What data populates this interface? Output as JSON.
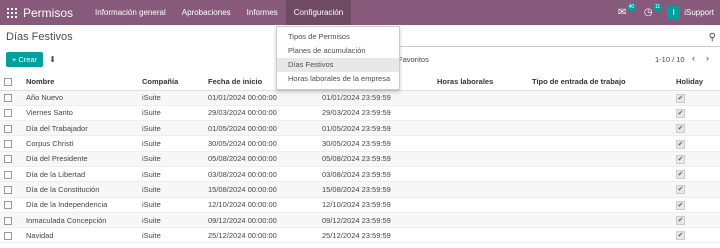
{
  "navbar": {
    "app_title": "Permisos",
    "menu": [
      "Información general",
      "Aprobaciones",
      "Informes",
      "Configuración"
    ],
    "chat_badge": "40",
    "activity_badge": "11",
    "avatar_letter": "I",
    "user_name": "iSupport"
  },
  "breadcrumb": "Días Festivos",
  "toolbar": {
    "create_label": "Crear",
    "favorites_label": "Favoritos",
    "pager": "1-10 / 10"
  },
  "dropdown": {
    "items": [
      "Tipos de Permisos",
      "Planes de acumulación",
      "Días Festivos",
      "Horas laborales de la empresa"
    ],
    "selected_index": 2
  },
  "table": {
    "columns": [
      "Nombre",
      "Compañía",
      "Fecha de inicio",
      "",
      "Horas laborales",
      "Tipo de entrada de trabajo",
      "Holiday"
    ],
    "rows": [
      {
        "name": "Año Nuevo",
        "company": "iSuite",
        "start": "01/01/2024 00:00:00",
        "end": "01/01/2024 23:59:59",
        "holiday": true
      },
      {
        "name": "Viernes Santo",
        "company": "iSuite",
        "start": "29/03/2024 00:00:00",
        "end": "29/03/2024 23:59:59",
        "holiday": true
      },
      {
        "name": "Día del Trabajador",
        "company": "iSuite",
        "start": "01/05/2024 00:00:00",
        "end": "01/05/2024 23:59:59",
        "holiday": true
      },
      {
        "name": "Corpus Christi",
        "company": "iSuite",
        "start": "30/05/2024 00:00:00",
        "end": "30/05/2024 23:59:59",
        "holiday": true
      },
      {
        "name": "Día del Presidente",
        "company": "iSuite",
        "start": "05/08/2024 00:00:00",
        "end": "05/08/2024 23:59:59",
        "holiday": true
      },
      {
        "name": "Día de la Libertad",
        "company": "iSuite",
        "start": "03/08/2024 00:00:00",
        "end": "03/08/2024 23:59:59",
        "holiday": true
      },
      {
        "name": "Día de la Constitución",
        "company": "iSuite",
        "start": "15/08/2024 00:00:00",
        "end": "15/08/2024 23:59:59",
        "holiday": true
      },
      {
        "name": "Día de la Independencia",
        "company": "iSuite",
        "start": "12/10/2024 00:00:00",
        "end": "12/10/2024 23:59:59",
        "holiday": true
      },
      {
        "name": "Inmaculada Concepción",
        "company": "iSuite",
        "start": "09/12/2024 00:00:00",
        "end": "09/12/2024 23:59:59",
        "holiday": true
      },
      {
        "name": "Navidad",
        "company": "iSuite",
        "start": "25/12/2024 00:00:00",
        "end": "25/12/2024 23:59:59",
        "holiday": true
      }
    ]
  },
  "colors": {
    "brand": "#875a7b",
    "primary_button": "#00a09d"
  },
  "icons": [
    "apps-grid-icon",
    "chat-icon",
    "clock-icon",
    "search-icon",
    "download-icon",
    "chevron-left-icon",
    "chevron-right-icon",
    "check-icon"
  ]
}
